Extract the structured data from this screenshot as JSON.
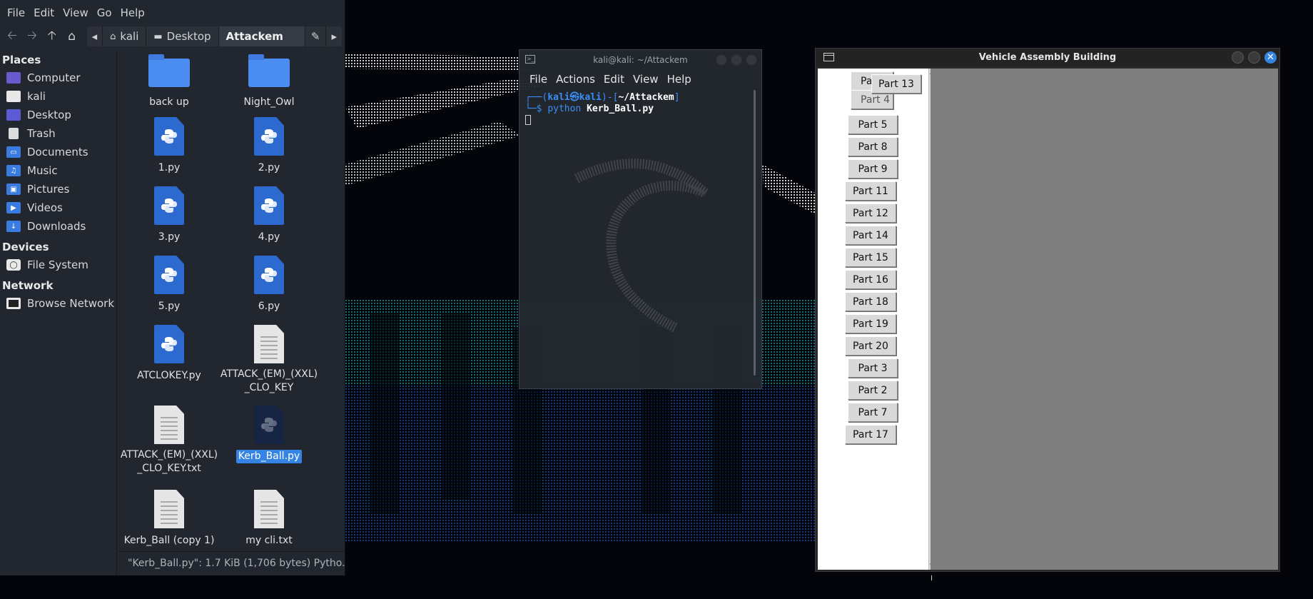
{
  "file_manager": {
    "menu": [
      "File",
      "Edit",
      "View",
      "Go",
      "Help"
    ],
    "path": [
      "kali",
      "Desktop",
      "Attackem"
    ],
    "places_heading": "Places",
    "places": [
      {
        "label": "Computer",
        "icon": "computer-icon",
        "color": "#6a5acd"
      },
      {
        "label": "kali",
        "icon": "home-folder-icon",
        "color": "#e8e8e8"
      },
      {
        "label": "Desktop",
        "icon": "desktop-folder-icon",
        "color": "#5b5bd6"
      },
      {
        "label": "Trash",
        "icon": "trash-icon",
        "color": "#dcdcdc"
      },
      {
        "label": "Documents",
        "icon": "documents-folder-icon",
        "color": "#3a7be0"
      },
      {
        "label": "Music",
        "icon": "music-folder-icon",
        "color": "#3a7be0"
      },
      {
        "label": "Pictures",
        "icon": "pictures-folder-icon",
        "color": "#3a7be0"
      },
      {
        "label": "Videos",
        "icon": "videos-folder-icon",
        "color": "#3a7be0"
      },
      {
        "label": "Downloads",
        "icon": "downloads-folder-icon",
        "color": "#3a7be0"
      }
    ],
    "devices_heading": "Devices",
    "devices": [
      {
        "label": "File System",
        "icon": "drive-icon"
      }
    ],
    "network_heading": "Network",
    "network": [
      {
        "label": "Browse Network",
        "icon": "network-icon"
      }
    ],
    "files": [
      {
        "name": "back up",
        "type": "folder"
      },
      {
        "name": "Night_Owl",
        "type": "folder"
      },
      {
        "name": "1.py",
        "type": "python"
      },
      {
        "name": "2.py",
        "type": "python"
      },
      {
        "name": "3.py",
        "type": "python"
      },
      {
        "name": "4.py",
        "type": "python"
      },
      {
        "name": "5.py",
        "type": "python"
      },
      {
        "name": "6.py",
        "type": "python"
      },
      {
        "name": "ATCLOKEY.py",
        "type": "python"
      },
      {
        "name": "ATTACK_(EM)_(XXL)_CLO_KEY",
        "line1": "ATTACK_(EM)_(XXL)",
        "line2": "_CLO_KEY",
        "type": "text"
      },
      {
        "name": "ATTACK_(EM)_(XXL)_CLO_KEY.txt",
        "line1": "ATTACK_(EM)_(XXL)",
        "line2": "_CLO_KEY.txt",
        "type": "text"
      },
      {
        "name": "Kerb_Ball.py",
        "type": "python",
        "selected": true
      },
      {
        "name": "Kerb_Ball (copy 1)",
        "type": "text"
      },
      {
        "name": "my cli.txt",
        "type": "text"
      }
    ],
    "status": "\"Kerb_Ball.py\": 1.7 KiB (1,706 bytes) Pytho..."
  },
  "terminal": {
    "title": "kali@kali: ~/Attackem",
    "menu": [
      "File",
      "Actions",
      "Edit",
      "View",
      "Help"
    ],
    "prompt_user": "kali",
    "prompt_host": "kali",
    "prompt_at": "㉿",
    "prompt_path": "~/Attackem",
    "command": "python",
    "argument": "Kerb_Ball.py"
  },
  "tk_window": {
    "title": "Vehicle Assembly Building",
    "parts": [
      {
        "label": "Part 1",
        "partial": "Par"
      },
      {
        "label": "Part 4",
        "partial": "Part 4"
      },
      {
        "label": "Part 13"
      },
      {
        "label": "Part 5"
      },
      {
        "label": "Part 8"
      },
      {
        "label": "Part 9"
      },
      {
        "label": "Part 11"
      },
      {
        "label": "Part 12"
      },
      {
        "label": "Part 14"
      },
      {
        "label": "Part 15"
      },
      {
        "label": "Part 16"
      },
      {
        "label": "Part 18"
      },
      {
        "label": "Part 19"
      },
      {
        "label": "Part 20"
      },
      {
        "label": "Part 3"
      },
      {
        "label": "Part 2"
      },
      {
        "label": "Part 7"
      },
      {
        "label": "Part 17"
      }
    ]
  },
  "colors": {
    "accent": "#3584e4",
    "folder": "#4b8cf0",
    "python_doc": "#2d6ad0",
    "canvas_grey": "#7f7f7f"
  }
}
